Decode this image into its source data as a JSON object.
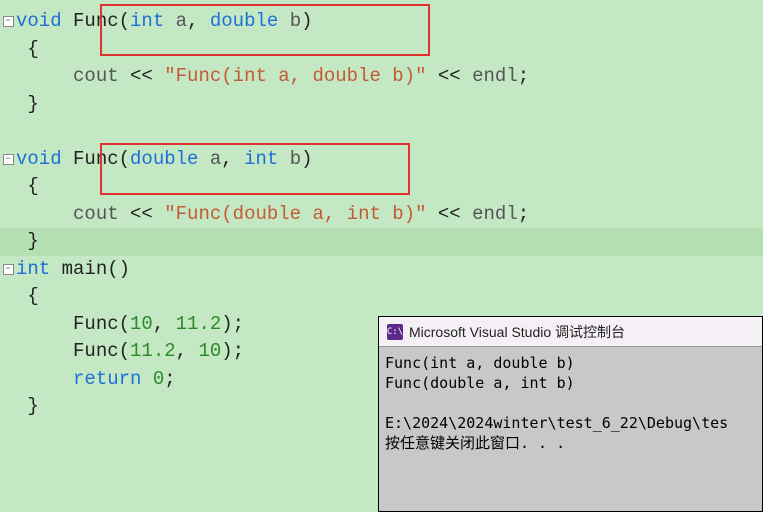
{
  "editor": {
    "blocks": [
      {
        "fold": true,
        "sig": {
          "ret": "void",
          "name": "Func",
          "p1_type": "int",
          "p1_name": "a",
          "p2_type": "double",
          "p2_name": "b"
        },
        "body": {
          "cout": "cout",
          "op": "<<",
          "str": "\"Func(int a, double b)\"",
          "endl": "endl"
        }
      },
      {
        "fold": true,
        "sig": {
          "ret": "void",
          "name": "Func",
          "p1_type": "double",
          "p1_name": "a",
          "p2_type": "int",
          "p2_name": "b"
        },
        "body": {
          "cout": "cout",
          "op": "<<",
          "str": "\"Func(double a, int b)\"",
          "endl": "endl"
        }
      }
    ],
    "main": {
      "ret": "int",
      "name": "main",
      "call1": {
        "fn": "Func",
        "a1": "10",
        "a2": "11.2"
      },
      "call2": {
        "fn": "Func",
        "a1": "11.2",
        "a2": "10"
      },
      "ret_kw": "return",
      "ret_val": "0"
    }
  },
  "console": {
    "icon": "C:\\",
    "title": "Microsoft Visual Studio 调试控制台",
    "out1": "Func(int a, double b)",
    "out2": "Func(double a, int b)",
    "path": "E:\\2024\\2024winter\\test_6_22\\Debug\\tes",
    "hint": "按任意键关闭此窗口. . ."
  }
}
